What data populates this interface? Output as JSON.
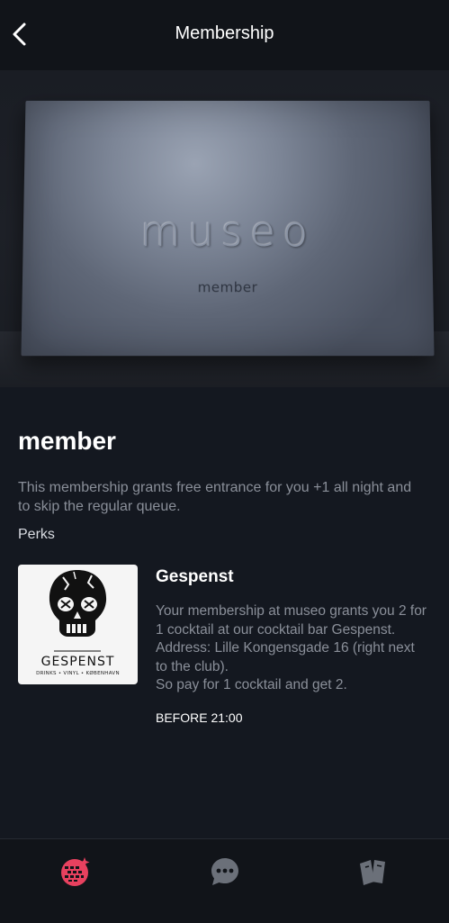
{
  "header": {
    "title": "Membership"
  },
  "card": {
    "logo_text": "museo",
    "tier_text": "member"
  },
  "membership": {
    "name": "member",
    "description": "This membership grants free entrance for you +1 all night and to skip the regular queue.",
    "perks_heading": "Perks"
  },
  "perks": [
    {
      "title": "Gespenst",
      "logo_text": "GESPENST",
      "logo_subtext": "DRINKS • VINYL • KØBENHAVN",
      "description_lines": [
        "Your membership at museo grants you 2 for 1 cocktail at our cocktail bar Gespenst. Address: Lille Kongensgade 16 (right next to the club).",
        "So pay for 1 cocktail and get 2."
      ],
      "time": "BEFORE 21:00"
    }
  ],
  "nav": {
    "items": [
      {
        "icon": "disco-ball-icon",
        "active": true
      },
      {
        "icon": "chat-bubble-icon",
        "active": false
      },
      {
        "icon": "tickets-icon",
        "active": false
      }
    ],
    "active_color": "#e8415f",
    "inactive_color": "#6b7079"
  },
  "colors": {
    "background": "#141820",
    "header": "#111419",
    "accent": "#e8415f"
  }
}
